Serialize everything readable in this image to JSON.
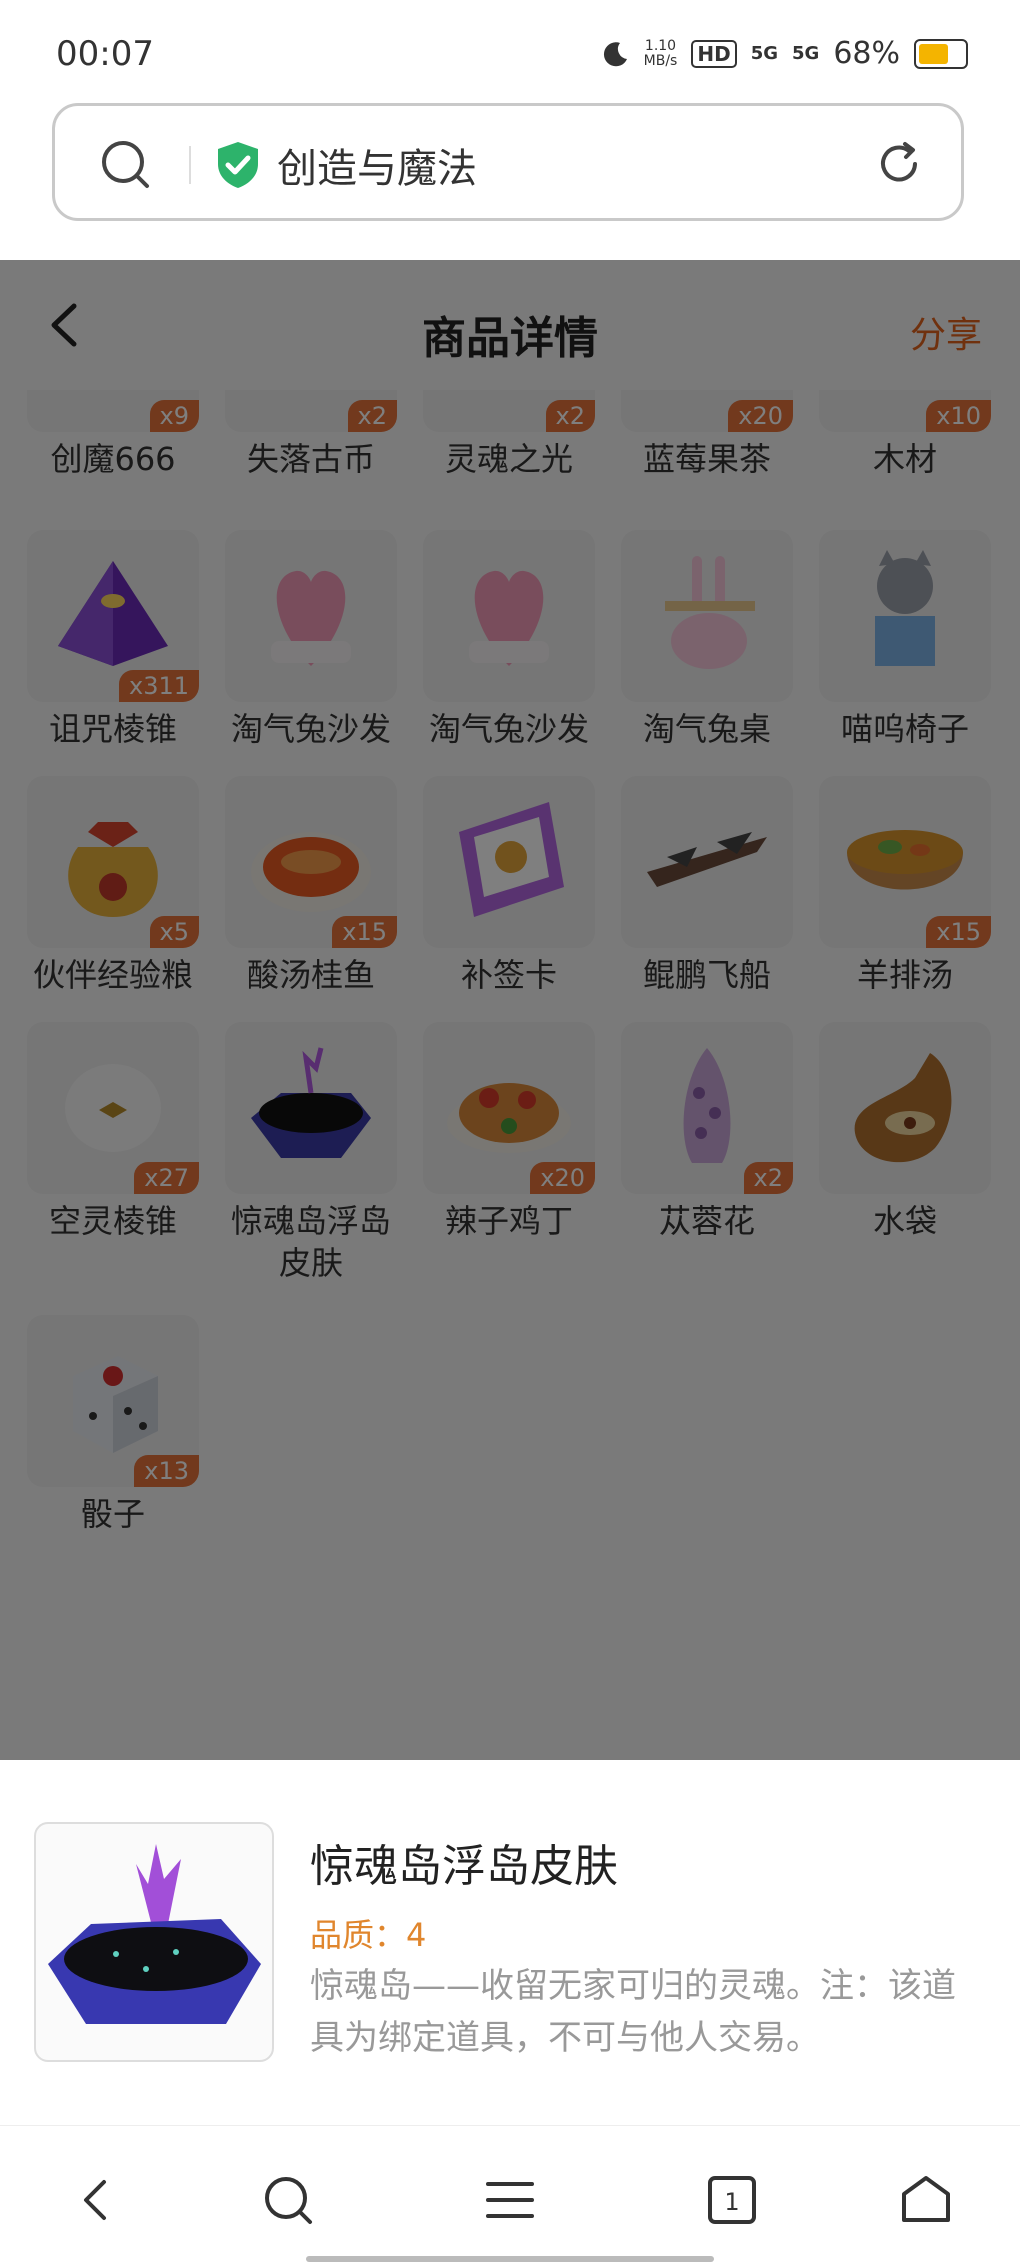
{
  "status_bar": {
    "time": "00:07",
    "net_speed_value": "1.10",
    "net_speed_unit": "MB/s",
    "hd": "HD",
    "sig1": "5G",
    "sig2": "5G",
    "battery": "68%",
    "battery_level": 0.68
  },
  "search": {
    "query": "创造与魔法"
  },
  "header": {
    "title": "商品详情",
    "share": "分享"
  },
  "items": [
    {
      "name": "创魔666",
      "count": "x9"
    },
    {
      "name": "失落古币",
      "count": "x2"
    },
    {
      "name": "灵魂之光",
      "count": "x2"
    },
    {
      "name": "蓝莓果茶",
      "count": "x20"
    },
    {
      "name": "木材",
      "count": "x10"
    },
    {
      "name": "诅咒棱锥",
      "count": "x311"
    },
    {
      "name": "淘气兔沙发",
      "count": ""
    },
    {
      "name": "淘气兔沙发",
      "count": ""
    },
    {
      "name": "淘气兔桌",
      "count": ""
    },
    {
      "name": "喵呜椅子",
      "count": ""
    },
    {
      "name": "伙伴经验粮",
      "count": "x5"
    },
    {
      "name": "酸汤桂鱼",
      "count": "x15"
    },
    {
      "name": "补签卡",
      "count": ""
    },
    {
      "name": "鲲鹏飞船",
      "count": ""
    },
    {
      "name": "羊排汤",
      "count": "x15"
    },
    {
      "name": "空灵棱锥",
      "count": "x27"
    },
    {
      "name": "惊魂岛浮岛皮肤",
      "count": ""
    },
    {
      "name": "辣子鸡丁",
      "count": "x20"
    },
    {
      "name": "苁蓉花",
      "count": "x2"
    },
    {
      "name": "水袋",
      "count": ""
    },
    {
      "name": "骰子",
      "count": "x13"
    }
  ],
  "detail": {
    "title": "惊魂岛浮岛皮肤",
    "quality": "品质：4",
    "description": "惊魂岛——收留无家可归的灵魂。注：该道具为绑定道具，不可与他人交易。"
  },
  "colors": {
    "accent": "#e0621d",
    "badge": "#e5733a",
    "quality": "#e0862d",
    "shield": "#2db36b"
  }
}
